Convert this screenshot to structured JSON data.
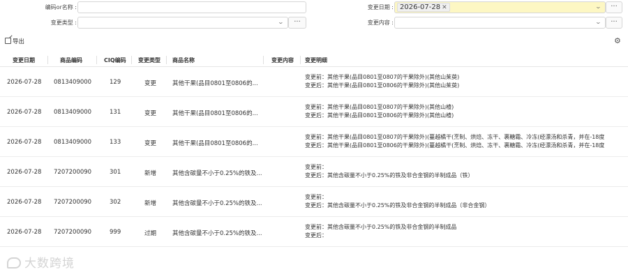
{
  "filters": {
    "code_or_name_label": "编码or名称 :",
    "code_or_name_value": "",
    "change_date_label": "变更日期 :",
    "change_date_tag": "2026-07-28",
    "change_type_label": "变更类型 :",
    "change_type_value": "",
    "change_content_label": "变更内容 :",
    "change_content_value": "",
    "more_label": "···"
  },
  "toolbar": {
    "export_label": "导出"
  },
  "table": {
    "headers": [
      "变更日期",
      "商品编码",
      "CIQ编码",
      "变更类型",
      "商品名称",
      "变更内容",
      "变更明细"
    ],
    "rows": [
      {
        "date": "2026-07-28",
        "code": "0813409000",
        "ciq": "129",
        "type": "变更",
        "name": "其他干果(品目0801至0806的...",
        "content": "",
        "before": "变更前：其他干果(品目0801至0807的干果除外)(其他山茱萸)",
        "after": "变更后：其他干果(品目0801至0806的干果除外)(其他山茱萸)"
      },
      {
        "date": "2026-07-28",
        "code": "0813409000",
        "ciq": "131",
        "type": "变更",
        "name": "其他干果(品目0801至0806的...",
        "content": "",
        "before": "变更前：其他干果(品目0801至0807的干果除外)(其他山楂)",
        "after": "变更后：其他干果(品目0801至0806的干果除外)(其他山楂)"
      },
      {
        "date": "2026-07-28",
        "code": "0813409000",
        "ciq": "133",
        "type": "变更",
        "name": "其他干果(品目0801至0806的...",
        "content": "",
        "before": "变更前：其他干果(品目0801至0807的干果除外)(蔓越橘干(烹制、烘焙、冻干、裹糖霜、冷冻(经漂汤和杀青，并在-18度",
        "after": "变更后：其他干果(品目0801至0806的干果除外)(蔓越橘干(烹制、烘焙、冻干、裹糖霜、冷冻(经漂汤和杀青，并在-18度"
      },
      {
        "date": "2026-07-28",
        "code": "7207200090",
        "ciq": "301",
        "type": "新增",
        "name": "其他含碳量不小于0.25%的铁及...",
        "content": "",
        "before": "变更前：",
        "after": "变更后：其他含碳量不小于0.25%的铁及非合金钢的半制成品（铁）"
      },
      {
        "date": "2026-07-28",
        "code": "7207200090",
        "ciq": "302",
        "type": "新增",
        "name": "其他含碳量不小于0.25%的铁及...",
        "content": "",
        "before": "变更前：",
        "after": "变更后：其他含碳量不小于0.25%的铁及非合金钢的半制成品（非合金钢）"
      },
      {
        "date": "2026-07-28",
        "code": "7207200090",
        "ciq": "999",
        "type": "过期",
        "name": "其他含碳量不小于0.25%的铁及...",
        "content": "",
        "before": "变更前：其他含碳量不小于0.25%的铁及非合金钢的半制成品",
        "after": "变更后："
      }
    ]
  },
  "watermark": {
    "text": "大数跨境"
  },
  "icons": {
    "export": "export-icon",
    "settings": "gear-icon",
    "chevron": "chevron-down-icon",
    "tag_close": "close-icon"
  }
}
